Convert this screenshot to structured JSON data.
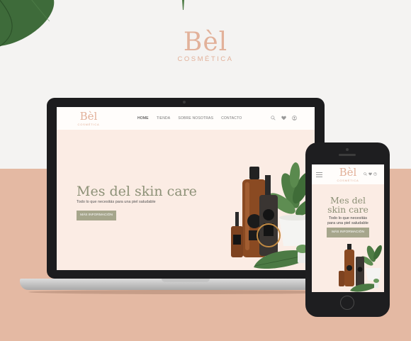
{
  "brand": {
    "name": "Bèl",
    "tagline": "COSMÉTICA"
  },
  "desktop_site": {
    "logo": {
      "name": "Bèl",
      "tagline": "COSMÉTICA"
    },
    "nav": [
      {
        "label": "HOME",
        "active": true
      },
      {
        "label": "TIENDA",
        "active": false
      },
      {
        "label": "SOBRE NOSOTRAS",
        "active": false
      },
      {
        "label": "CONTACTO",
        "active": false
      }
    ],
    "icons": [
      "search-icon",
      "heart-icon",
      "user-icon"
    ],
    "hero": {
      "title": "Mes del skin care",
      "subtitle": "Todo lo que necesitás para una piel saludable",
      "button": "MÁS INFORMACIÓN"
    },
    "product_label": "COSMETIC MOCK UP PACK"
  },
  "mobile_site": {
    "logo": {
      "name": "Bèl",
      "tagline": "COSMÉTICA"
    },
    "icons": [
      "search-icon",
      "heart-icon",
      "user-icon"
    ],
    "hero": {
      "title_line1": "Mes del",
      "title_line2": "skin care",
      "subtitle_line1": "Todo lo que necesitás",
      "subtitle_line2": "para una piel saludable",
      "button": "MÁS INFORMACIÓN"
    }
  },
  "colors": {
    "brand_peach": "#e2b19a",
    "hero_olive": "#8d9177",
    "button_olive": "#a6a68c",
    "hero_background": "#fbece4",
    "backdrop_peach": "#e4b9a3",
    "backdrop_light": "#f4f3f2"
  }
}
